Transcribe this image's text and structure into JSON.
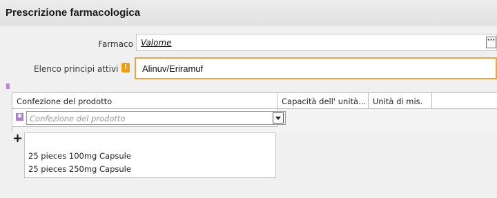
{
  "header": {
    "title": "Prescrizione farmacologica"
  },
  "form": {
    "farmaco": {
      "label": "Farmaco",
      "value": "Valome",
      "lookup_button": "···"
    },
    "principi_attivi": {
      "label": "Elenco principi attivi",
      "warning_icon": "!",
      "value": "Alinuv/Eriramuf"
    }
  },
  "grid": {
    "columns": [
      "Confezione del prodotto",
      "Capacità dell' unità...",
      "Unità di mis.",
      ""
    ],
    "new_row": {
      "placeholder": "Confezione del prodotto"
    },
    "add_button": "+"
  },
  "dropdown": {
    "options": [
      "25 pieces 100mg Capsule",
      "25 pieces 250mg Capsule"
    ]
  },
  "colors": {
    "warning": "#f39c12",
    "field_highlight": "#f0a43c",
    "row_marker": "#b57ad6"
  }
}
